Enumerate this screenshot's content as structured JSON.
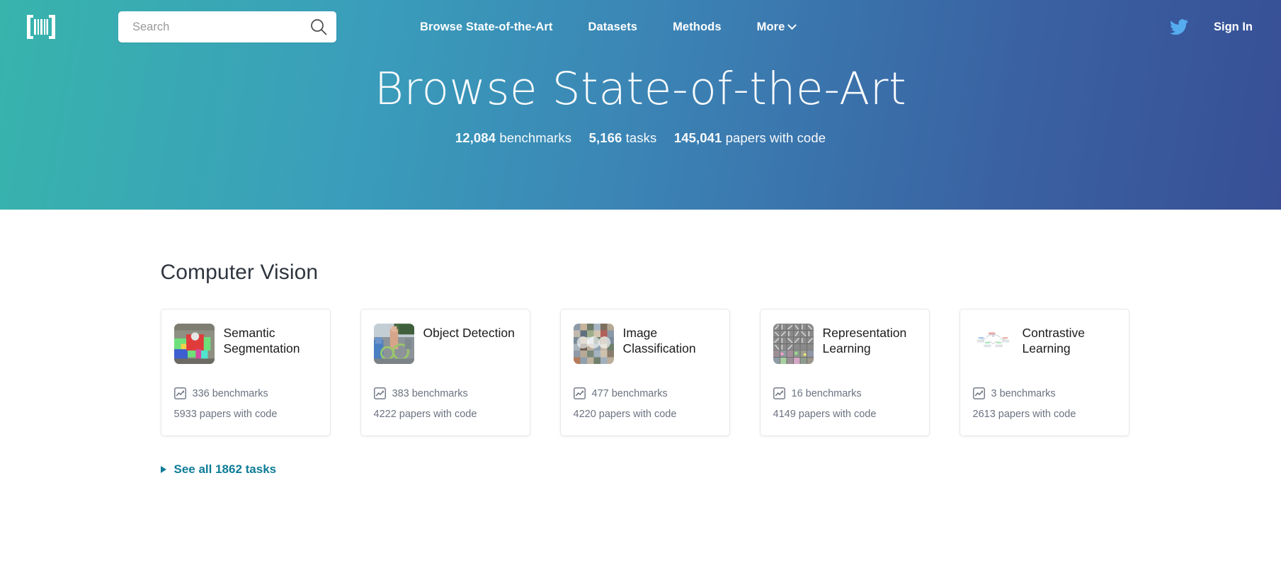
{
  "brand": {
    "logo_icon": "barcode-logo-icon",
    "accent_teal": "#38b4ac",
    "accent_blue": "#384f96",
    "link_teal": "#0e7c96",
    "twitter_blue": "#55acee"
  },
  "navbar": {
    "search": {
      "placeholder": "Search",
      "value": "",
      "icon": "search-icon"
    },
    "links": [
      {
        "label": "Browse State-of-the-Art",
        "has_chevron": false
      },
      {
        "label": "Datasets",
        "has_chevron": false
      },
      {
        "label": "Methods",
        "has_chevron": false
      },
      {
        "label": "More",
        "has_chevron": true
      }
    ],
    "twitter_icon": "twitter-bird-icon",
    "signin_label": "Sign In"
  },
  "hero": {
    "title": "Browse State-of-the-Art",
    "stats": [
      {
        "number": "12,084",
        "label": "benchmarks"
      },
      {
        "number": "5,166",
        "label": "tasks"
      },
      {
        "number": "145,041",
        "label": "papers with code"
      }
    ]
  },
  "section": {
    "title": "Computer Vision",
    "see_all_label": "See all 1862 tasks",
    "cards": [
      {
        "title": "Semantic Segmentation",
        "benchmarks": "336 benchmarks",
        "papers": "5933 papers with code",
        "thumb": "semantic-segmentation-thumbnail"
      },
      {
        "title": "Object Detection",
        "benchmarks": "383 benchmarks",
        "papers": "4222 papers with code",
        "thumb": "object-detection-thumbnail"
      },
      {
        "title": "Image Classification",
        "benchmarks": "477 benchmarks",
        "papers": "4220 papers with code",
        "thumb": "image-classification-thumbnail"
      },
      {
        "title": "Representation Learning",
        "benchmarks": "16 benchmarks",
        "papers": "4149 papers with code",
        "thumb": "representation-learning-thumbnail"
      },
      {
        "title": "Contrastive Learning",
        "benchmarks": "3 benchmarks",
        "papers": "2613 papers with code",
        "thumb": "contrastive-learning-thumbnail"
      }
    ]
  }
}
